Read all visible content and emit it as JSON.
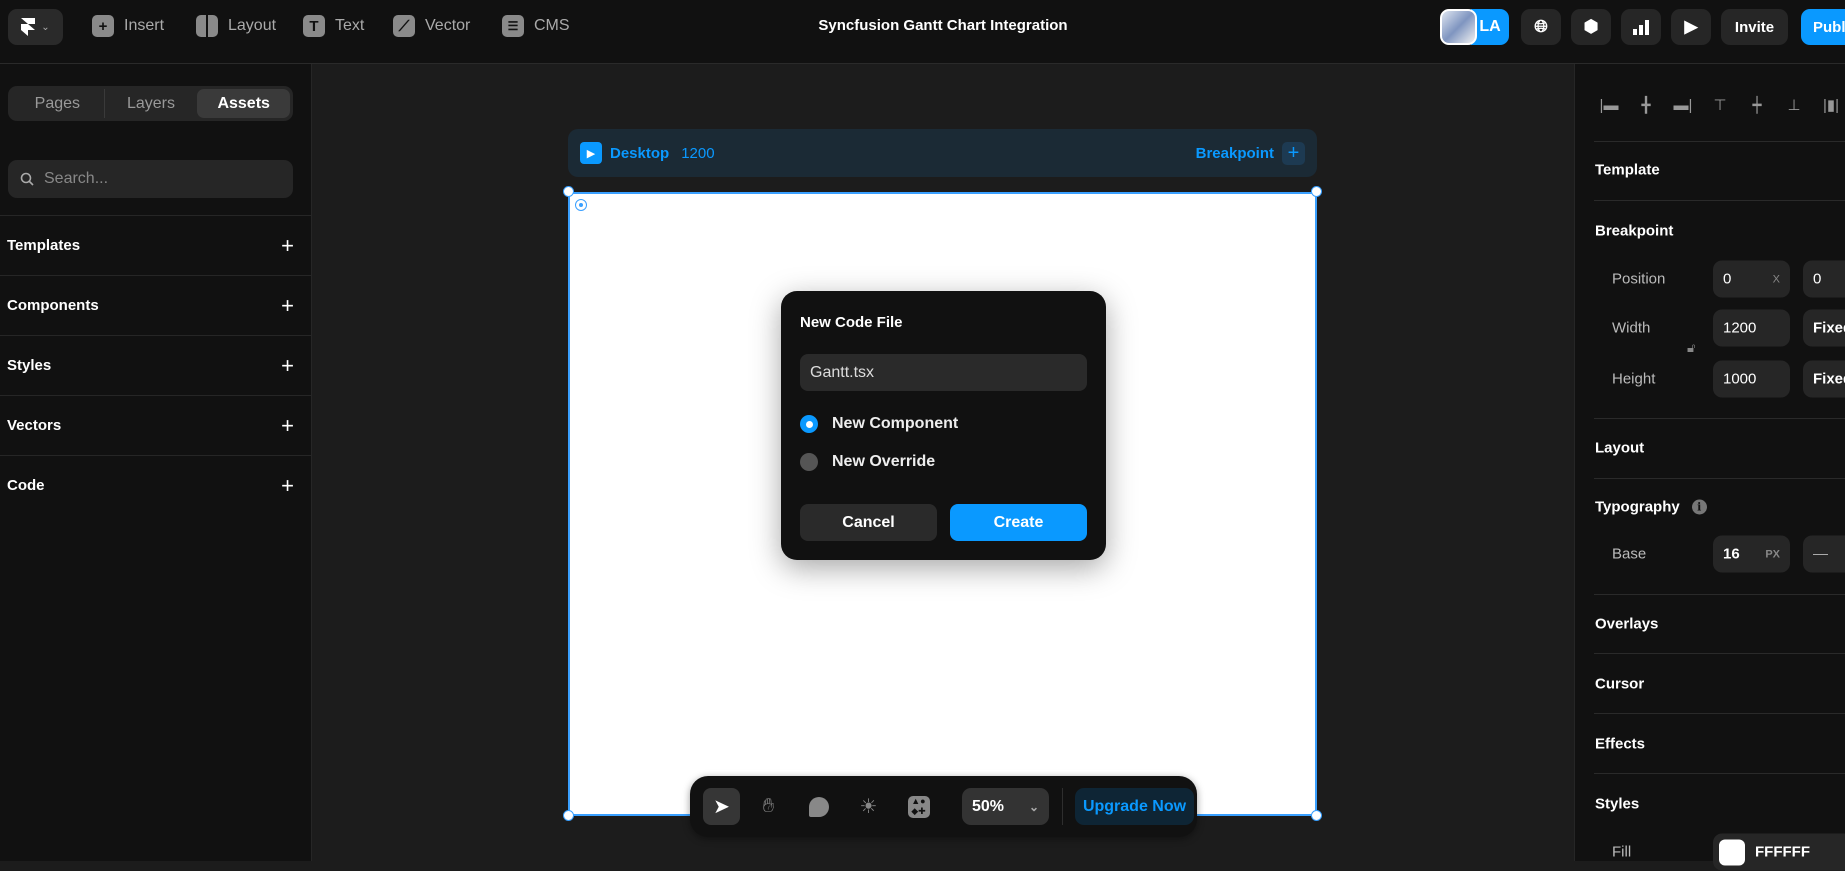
{
  "topbar": {
    "title": "Syncfusion Gantt Chart Integration",
    "menu": [
      {
        "label": "Insert",
        "icon": "plus-square-icon"
      },
      {
        "label": "Layout",
        "icon": "layout-icon"
      },
      {
        "label": "Text",
        "icon": "text-icon"
      },
      {
        "label": "Vector",
        "icon": "vector-icon"
      },
      {
        "label": "CMS",
        "icon": "database-icon"
      }
    ],
    "avatar_initials": "LA",
    "invite": "Invite",
    "publish": "Publ"
  },
  "left": {
    "tabs": [
      {
        "label": "Pages"
      },
      {
        "label": "Layers"
      },
      {
        "label": "Assets",
        "active": true
      }
    ],
    "search_placeholder": "Search...",
    "sections": [
      {
        "label": "Templates"
      },
      {
        "label": "Components"
      },
      {
        "label": "Styles"
      },
      {
        "label": "Vectors"
      },
      {
        "label": "Code"
      }
    ]
  },
  "breakpoint_bar": {
    "name": "Desktop",
    "width": "1200",
    "add_label": "Breakpoint"
  },
  "dialog": {
    "title": "New Code File",
    "filename": "Gantt.tsx",
    "options": [
      {
        "label": "New Component",
        "selected": true
      },
      {
        "label": "New Override",
        "selected": false
      }
    ],
    "cancel": "Cancel",
    "create": "Create"
  },
  "toolbar": {
    "zoom": "50%",
    "upgrade": "Upgrade Now"
  },
  "right": {
    "template": "Template",
    "breakpoint": "Breakpoint",
    "position_label": "Position",
    "position_x": "0",
    "position_x_unit": "X",
    "position_y": "0",
    "width_label": "Width",
    "width_value": "1200",
    "width_mode": "Fixed",
    "height_label": "Height",
    "height_value": "1000",
    "height_mode": "Fixed",
    "layout": "Layout",
    "typography": "Typography",
    "base_label": "Base",
    "base_value": "16",
    "base_unit": "PX",
    "base_minus": "—",
    "overlays": "Overlays",
    "cursor": "Cursor",
    "effects": "Effects",
    "styles": "Styles",
    "fill_label": "Fill",
    "fill_value": "FFFFFF"
  },
  "colors": {
    "accent": "#0099ff",
    "panel": "#111111",
    "canvas": "#1c1c1c"
  }
}
